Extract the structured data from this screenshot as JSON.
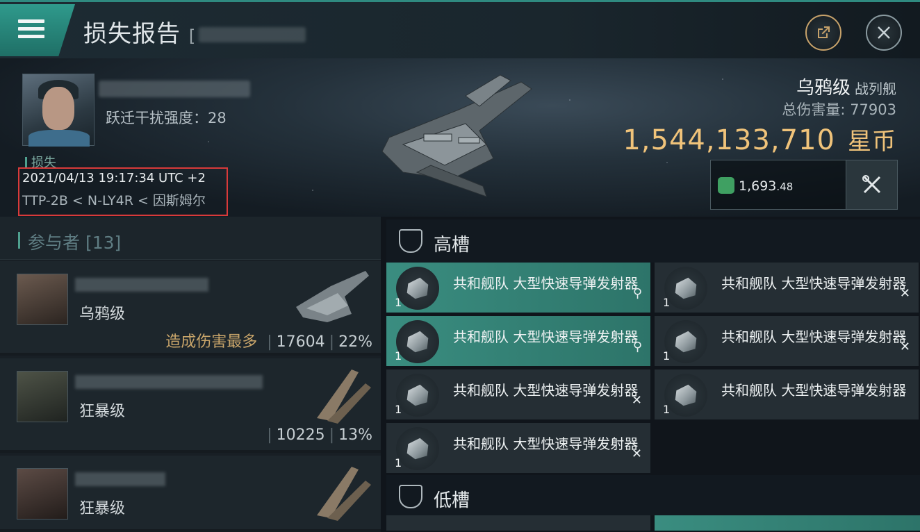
{
  "header": {
    "title": "损失报告",
    "title_suffix": "[",
    "export_icon": "external-link-icon",
    "close_icon": "close-icon"
  },
  "victim": {
    "jam_label": "跃迁干扰强度：",
    "jam_value": "28",
    "loss_label": "损失",
    "timestamp": "2021/04/13 19:17:34 UTC +2",
    "route": "TTP-2B < N-LY4R < 因斯姆尔"
  },
  "ship": {
    "name": "乌鸦级",
    "class": "战列舰",
    "damage_label": "总伤害量:",
    "damage_value": "77903",
    "value": "1,544,133,710",
    "currency": "星币",
    "plex_value": "1,693",
    "plex_decimal": ".48"
  },
  "participants": {
    "header": "参与者 [13]",
    "rows": [
      {
        "ship": "乌鸦级",
        "badge": "造成伤害最多",
        "damage": "17604",
        "percent": "22%"
      },
      {
        "ship": "狂暴级",
        "badge": "",
        "damage": "10225",
        "percent": "13%"
      },
      {
        "ship": "狂暴级",
        "badge": "",
        "damage": "",
        "percent": ""
      }
    ]
  },
  "slots": {
    "high": {
      "title": "高槽",
      "items": [
        {
          "name": "共和舰队 大型快速导弹发射器",
          "qty": "1",
          "highlight": true
        },
        {
          "name": "共和舰队 大型快速导弹发射器",
          "qty": "1",
          "highlight": false
        },
        {
          "name": "共和舰队 大型快速导弹发射器",
          "qty": "1",
          "highlight": true
        },
        {
          "name": "共和舰队 大型快速导弹发射器",
          "qty": "1",
          "highlight": false
        },
        {
          "name": "共和舰队 大型快速导弹发射器",
          "qty": "1",
          "highlight": false
        },
        {
          "name": "共和舰队 大型快速导弹发射器",
          "qty": "1",
          "highlight": false
        },
        {
          "name": "共和舰队 大型快速导弹发射器",
          "qty": "1",
          "highlight": false
        }
      ]
    },
    "low": {
      "title": "低槽"
    }
  },
  "colors": {
    "accent": "#2f9a8c",
    "gold": "#f0c37a",
    "alert": "#d93a3a"
  }
}
